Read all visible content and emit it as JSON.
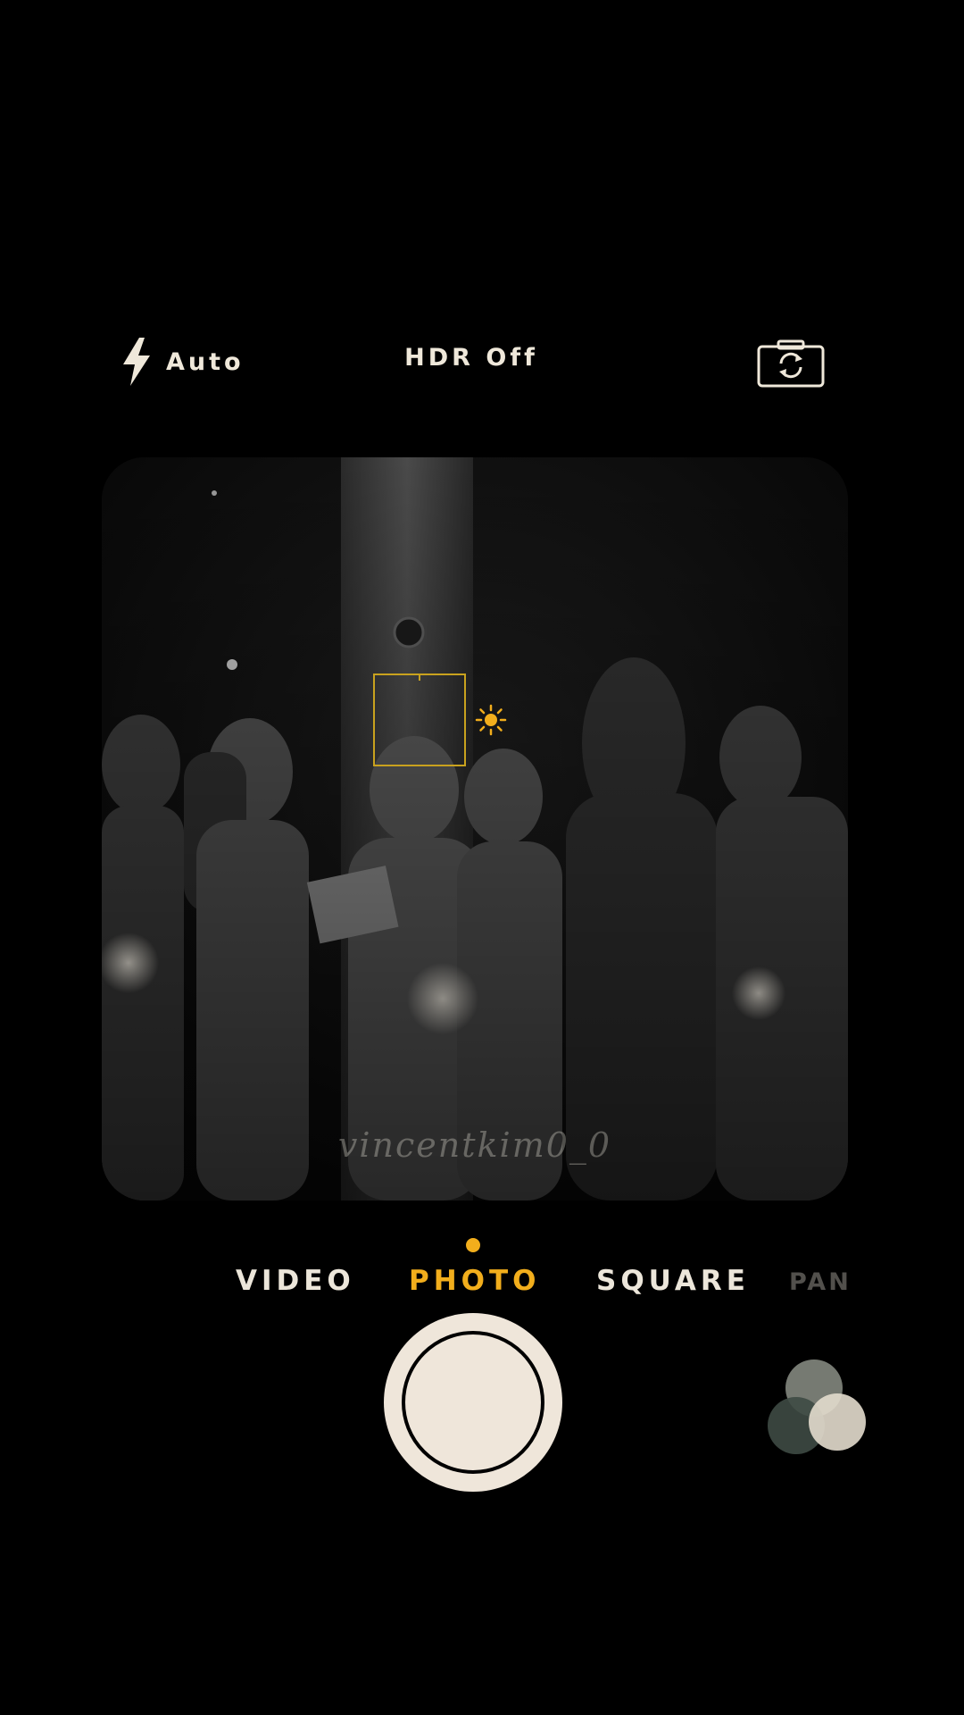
{
  "top_bar": {
    "flash_label": "Auto",
    "flash_icon": "lightning-bolt-icon",
    "hdr_label": "HDR Off",
    "switch_camera_icon": "camera-rotate-icon"
  },
  "viewfinder": {
    "watermark": "vincentkim0_0",
    "focus_icon": "focus-square-icon",
    "exposure_icon": "sun-icon"
  },
  "modes": {
    "items": [
      "VIDEO",
      "PHOTO",
      "SQUARE",
      "PANO"
    ],
    "selected": "PHOTO"
  },
  "bottom_bar": {
    "shutter_icon": "shutter-button",
    "filters_icon": "filters-icon"
  },
  "colors": {
    "accent": "#f2ae1c",
    "text": "#efe8da",
    "background": "#000000"
  }
}
